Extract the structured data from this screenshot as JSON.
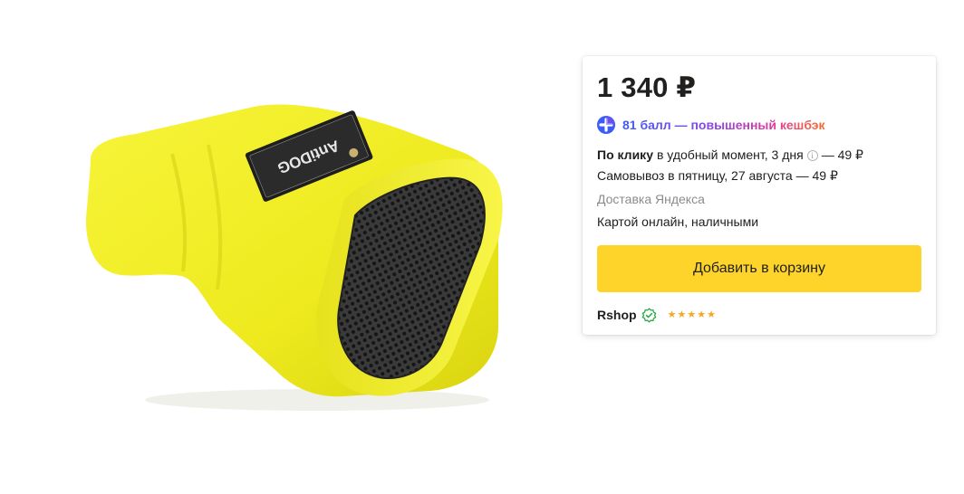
{
  "product": {
    "image_label": "AntiDOG"
  },
  "offer": {
    "price": "1 340 ₽",
    "cashback": "81 балл — повышенный кешбэк",
    "delivery_line1_bold": "По клику",
    "delivery_line1_text": "в удобный момент, 3 дня",
    "delivery_line1_price": "— 49 ₽",
    "info_glyph": "i",
    "pickup": "Самовывоз в пятницу, 27 августа — 49 ₽",
    "carrier": "Доставка Яндекса",
    "payment": "Картой онлайн, наличными",
    "add_to_cart": "Добавить в корзину",
    "shop_name": "Rshop",
    "rating_stars": 5,
    "star_glyph": "★"
  },
  "colors": {
    "button": "#fed42b",
    "stars": "#f5a623",
    "verified": "#1ea83c",
    "plus_icon": "#3d5cf5",
    "product": "#f2f02a"
  },
  "icons": [
    "plus-cashback-icon",
    "info-icon",
    "verified-shop-icon",
    "star-icon"
  ]
}
